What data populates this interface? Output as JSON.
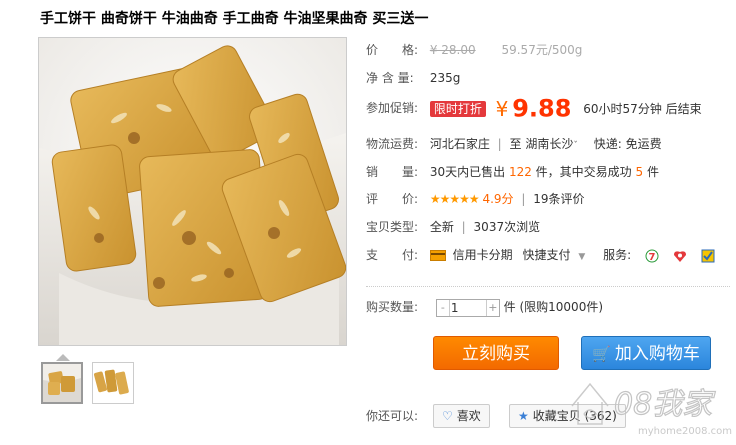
{
  "product": {
    "title": "手工饼干 曲奇饼干 牛油曲奇 手工曲奇 牛油坚果曲奇 买三送一"
  },
  "price_row": {
    "label": "价　　格:",
    "original_price": "¥ 28.00",
    "unit_price": "59.57元/500g"
  },
  "net_row": {
    "label": "净 含 量:",
    "value": "235g"
  },
  "promo_row": {
    "label": "参加促销:",
    "badge": "限时打折",
    "currency": "¥",
    "price": "9.88",
    "countdown": "60小时57分钟 后结束"
  },
  "shipping_row": {
    "label": "物流运费:",
    "from": "河北石家庄",
    "separator": "|",
    "to_prefix": "至",
    "to": "湖南长沙",
    "fee": "快递: 免运费"
  },
  "sales_row": {
    "label": "销　　量:",
    "prefix": "30天内已售出",
    "sold": "122",
    "mid": "件，其中交易成功",
    "success": "5",
    "suffix": "件"
  },
  "rating_row": {
    "label": "评　　价:",
    "stars": "★★★★★",
    "score": "4.9分",
    "separator": "|",
    "reviews": "19条评价"
  },
  "type_row": {
    "label": "宝贝类型:",
    "type": "全新",
    "separator": "|",
    "views": "3037次浏览"
  },
  "payment_row": {
    "label": "支　　付:",
    "method1": "信用卡分期",
    "method2": "快捷支付",
    "services_label": "服务:"
  },
  "quantity": {
    "label": "购买数量:",
    "value": "1",
    "minus": "-",
    "plus": "+",
    "limit": "件 (限购10000件)"
  },
  "actions": {
    "buy_now": "立刻购买",
    "add_cart": "加入购物车"
  },
  "share": {
    "label": "你还可以:",
    "like": "喜欢",
    "favorite": "收藏宝贝 (362)"
  },
  "watermark": {
    "brand": "08我家",
    "url": "myhome2008.com"
  },
  "colors": {
    "price_red": "#ff3300",
    "buy_orange": "#f36a00",
    "cart_blue": "#2b86dc",
    "badge_red": "#e4393c"
  }
}
